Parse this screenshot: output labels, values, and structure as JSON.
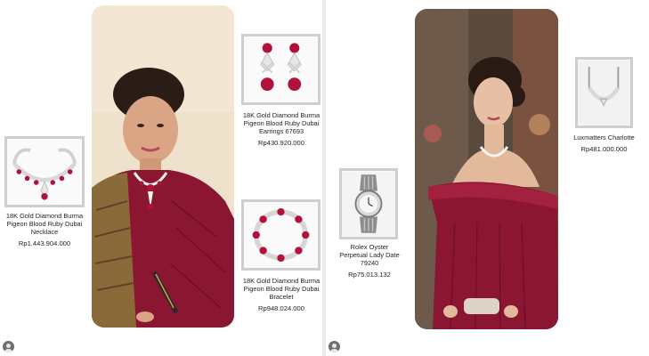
{
  "left_post": {
    "products": [
      {
        "name": "18K Gold Diamond Burma Pigeon Blood Ruby Dubai Earrings 67693",
        "price": "Rp430.920.000",
        "icon": "earrings"
      },
      {
        "name": "18K Gold Diamond Burma Pigeon Blood Ruby Dubai Necklace",
        "price": "Rp1.443.904.000",
        "icon": "necklace"
      },
      {
        "name": "18K Gold Diamond Burma Pigeon Blood Ruby Dubai Bracelet",
        "price": "Rp948.024.000",
        "icon": "bracelet"
      }
    ]
  },
  "right_post": {
    "products": [
      {
        "name": "Luxmatters Charlotte",
        "price": "Rp481.000.000",
        "icon": "diamond-necklace"
      },
      {
        "name": "Rolex Oyster Perpetual Lady Date 79240",
        "price": "Rp75.013.132",
        "icon": "watch"
      }
    ]
  },
  "colors": {
    "ruby": "#b0123a",
    "gown": "#8a1631",
    "background": "#e9ebee"
  }
}
